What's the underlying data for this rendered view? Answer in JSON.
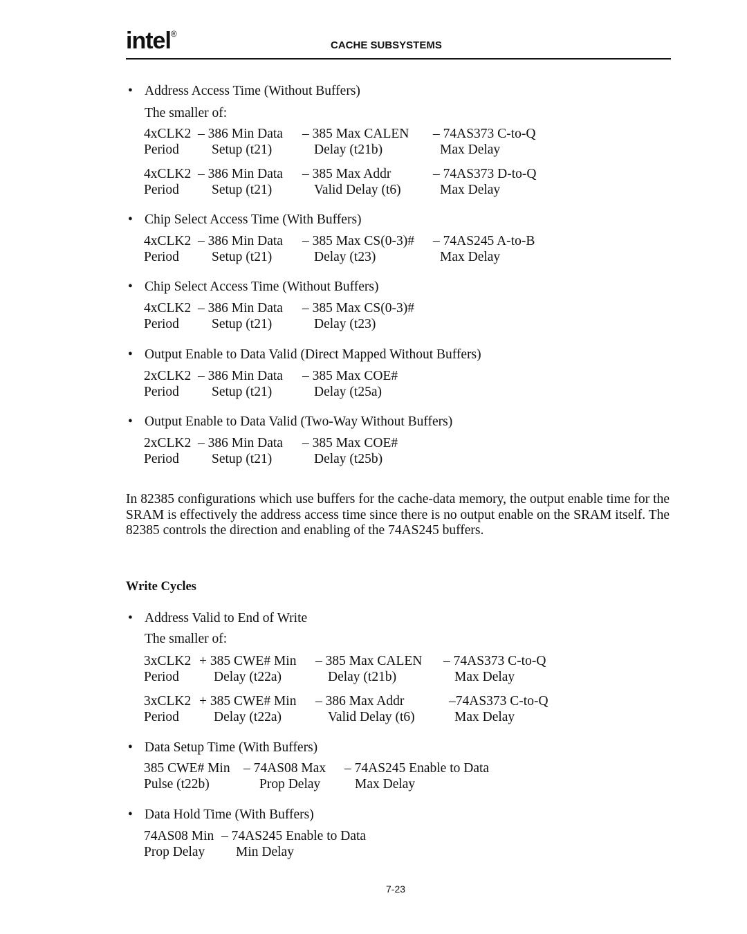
{
  "header": {
    "logo_text": "intel",
    "logo_mark": "®",
    "running_head": "CACHE SUBSYSTEMS"
  },
  "read_items": [
    {
      "title": "Address Access Time (Without Buffers)",
      "note": "The smaller of:",
      "formulas": [
        {
          "top": [
            "4xCLK2",
            "– 386 Min Data",
            "– 385 Max CALEN",
            "– 74AS373 C-to-Q"
          ],
          "bottom": [
            "Period",
            "Setup (t21)",
            "Delay (t21b)",
            "Max Delay"
          ]
        },
        {
          "top": [
            "4xCLK2",
            "– 386 Min Data",
            "– 385 Max Addr",
            "– 74AS373 D-to-Q"
          ],
          "bottom": [
            "Period",
            "Setup (t21)",
            "Valid Delay (t6)",
            "Max Delay"
          ]
        }
      ]
    },
    {
      "title": "Chip Select Access Time (With Buffers)",
      "formulas": [
        {
          "top": [
            "4xCLK2",
            "– 386 Min Data",
            "– 385 Max CS(0-3)#",
            "– 74AS245 A-to-B"
          ],
          "bottom": [
            "Period",
            "Setup (t21)",
            "Delay (t23)",
            "Max Delay"
          ]
        }
      ]
    },
    {
      "title": "Chip Select Access Time (Without Buffers)",
      "formulas": [
        {
          "top": [
            "4xCLK2",
            "– 386 Min Data",
            "– 385 Max CS(0-3)#"
          ],
          "bottom": [
            "Period",
            "Setup (t21)",
            "Delay (t23)"
          ]
        }
      ]
    },
    {
      "title": "Output Enable to Data Valid (Direct Mapped Without Buffers)",
      "formulas": [
        {
          "top": [
            "2xCLK2",
            "– 386 Min Data",
            "– 385 Max COE#"
          ],
          "bottom": [
            "Period",
            "Setup (t21)",
            "Delay (t25a)"
          ]
        }
      ]
    },
    {
      "title": "Output Enable to Data Valid (Two-Way Without Buffers)",
      "formulas": [
        {
          "top": [
            "2xCLK2",
            "– 386 Min Data",
            "– 385 Max COE#"
          ],
          "bottom": [
            "Period",
            "Setup (t21)",
            "Delay (t25b)"
          ]
        }
      ]
    }
  ],
  "paragraph": "In 82385 configurations which use buffers for the cache-data memory, the output enable time for the SRAM is effectively the address access time since there is no output enable on the SRAM itself. The 82385 controls the direction and enabling of the 74AS245 buffers.",
  "write_heading": "Write Cycles",
  "write_items": [
    {
      "title": "Address Valid to End of Write",
      "note": "The smaller of:",
      "formulas": [
        {
          "top": [
            "3xCLK2",
            "+ 385 CWE# Min",
            "– 385 Max CALEN",
            "– 74AS373 C-to-Q"
          ],
          "bottom": [
            "Period",
            "Delay (t22a)",
            "Delay (t21b)",
            "Max Delay"
          ]
        },
        {
          "top": [
            "3xCLK2",
            "+ 385 CWE# Min",
            "– 386 Max Addr",
            "–74AS373 C-to-Q"
          ],
          "bottom": [
            "Period",
            "Delay (t22a)",
            "Valid Delay (t6)",
            "Max Delay"
          ]
        }
      ]
    },
    {
      "title": "Data Setup Time (With Buffers)",
      "formulas": [
        {
          "top": [
            "385 CWE# Min",
            "– 74AS08 Max",
            "– 74AS245 Enable to Data"
          ],
          "bottom": [
            "Pulse (t22b)",
            "Prop Delay",
            "Max Delay"
          ]
        }
      ]
    },
    {
      "title": "Data Hold Time (With Buffers)",
      "formulas": [
        {
          "top": [
            "74AS08 Min",
            "– 74AS245 Enable to Data"
          ],
          "bottom": [
            "Prop Delay",
            "Min Delay"
          ]
        }
      ]
    }
  ],
  "bullet_glyph": "•",
  "page_number": "7-23"
}
